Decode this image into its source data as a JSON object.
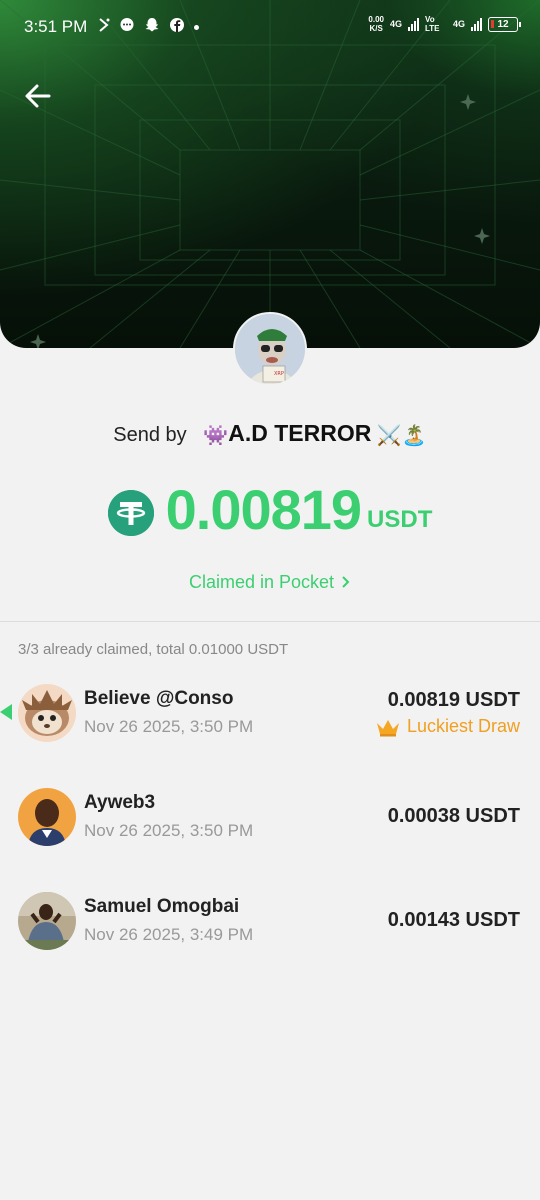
{
  "status_bar": {
    "time": "3:51 PM",
    "net_speed_value": "0.00",
    "net_speed_unit": "K/S",
    "network_1": "4G",
    "volte": "Vo LTE",
    "network_2": "4G",
    "battery": "12"
  },
  "header": {
    "back_icon": "arrow-left-icon"
  },
  "sender": {
    "prefix": "Send by",
    "emoji_before": "👾",
    "name": "A.D TERROR",
    "emoji_after": "⚔️🏝️"
  },
  "amount": {
    "value": "0.00819",
    "unit": "USDT",
    "token_icon": "tether-icon"
  },
  "claimed_link": "Claimed in Pocket",
  "summary": "3/3 already claimed, total 0.01000 USDT",
  "claims": [
    {
      "name": "Believe @Conso",
      "date": "Nov 26 2025, 3:50 PM",
      "amount": "0.00819 USDT",
      "badge": "Luckiest Draw"
    },
    {
      "name": "Ayweb3",
      "date": "Nov 26 2025, 3:50 PM",
      "amount": "0.00038 USDT"
    },
    {
      "name": "Samuel Omogbai",
      "date": "Nov 26 2025, 3:49 PM",
      "amount": "0.00143 USDT"
    }
  ],
  "colors": {
    "accent": "#3ccf72",
    "lucky": "#f0a020",
    "tether": "#26a17b"
  }
}
